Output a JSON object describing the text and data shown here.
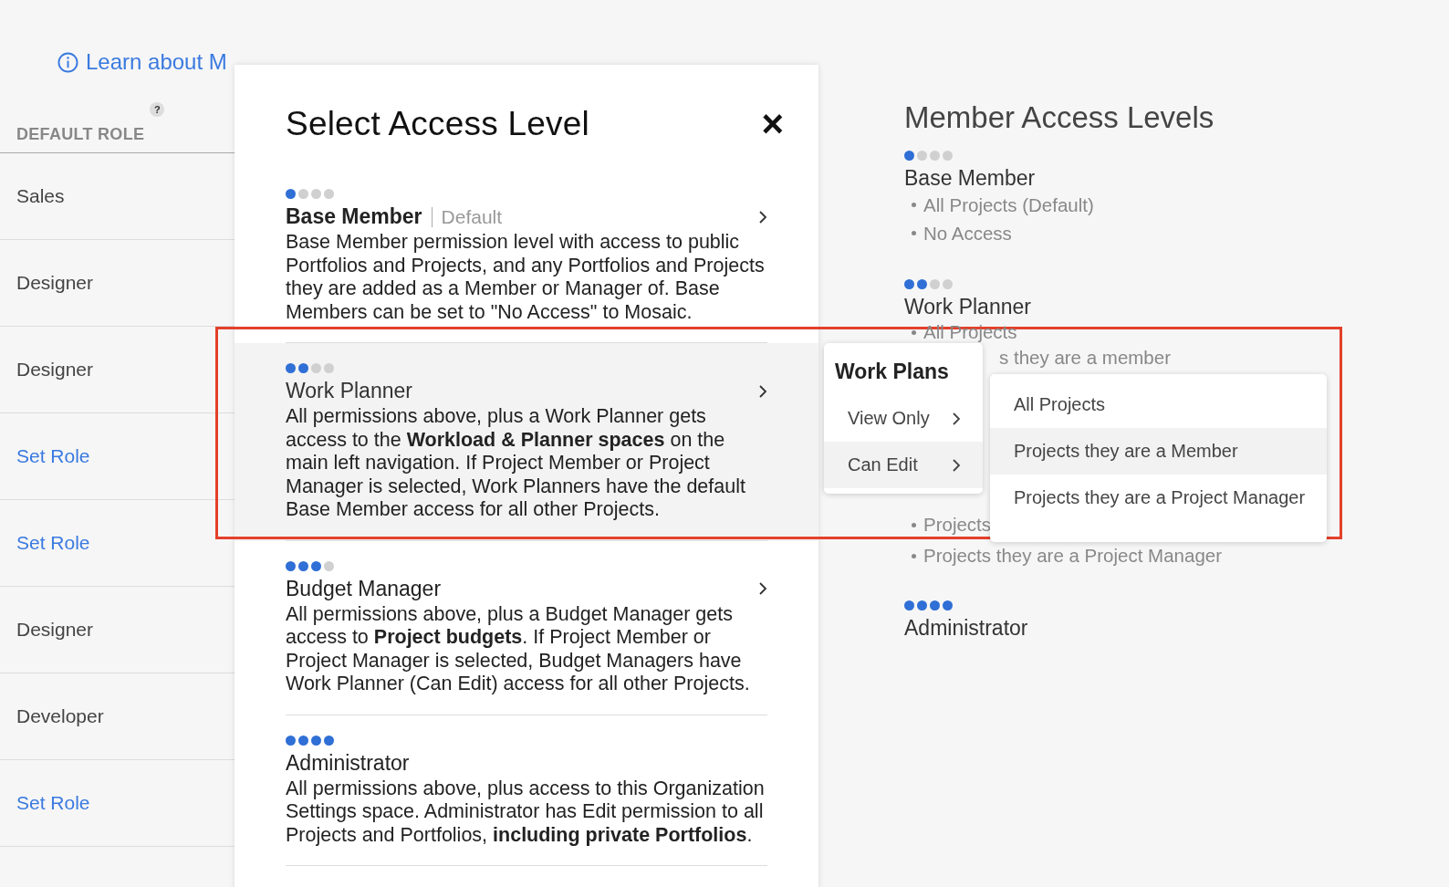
{
  "learn_link": "Learn about M",
  "roles_table": {
    "header": "DEFAULT ROLE",
    "help": "?",
    "rows": [
      {
        "text": "Sales",
        "kind": "value"
      },
      {
        "text": "Designer",
        "kind": "value"
      },
      {
        "text": "Designer",
        "kind": "value"
      },
      {
        "text": "Set Role",
        "kind": "link"
      },
      {
        "text": "Set Role",
        "kind": "link"
      },
      {
        "text": "Designer",
        "kind": "value"
      },
      {
        "text": "Developer",
        "kind": "value"
      },
      {
        "text": "Set Role",
        "kind": "link"
      }
    ]
  },
  "modal": {
    "title": "Select Access Level",
    "close": "×",
    "levels": [
      {
        "stars": 1,
        "name": "Base Member",
        "tag": "Default",
        "selected": false,
        "description": "Base Member permission level with access to public Portfolios and Projects, and any Portfolios and Projects they are added as a Member or Manager of. Base Members can be set to \"No Access\" to Mosaic."
      },
      {
        "stars": 2,
        "name": "Work Planner",
        "selected": true,
        "description": "All permissions above, plus a Work Planner gets access to the **Workload & Planner spaces** on the main left navigation. If Project Member or Project Manager is selected, Work Planners have the default Base Member access for all other Projects."
      },
      {
        "stars": 3,
        "name": "Budget Manager",
        "selected": false,
        "description": "All permissions above, plus a Budget Manager gets access to **Project budgets**. If Project Member or Project Manager is selected, Budget Managers have Work Planner (Can Edit) access for all other Projects."
      },
      {
        "stars": 4,
        "name": "Administrator",
        "selected": false,
        "description": "All permissions above, plus access to this Organization Settings space. Administrator has Edit permission to all Projects and Portfolios, **including private Portfolios**."
      }
    ]
  },
  "work_plans_menu": {
    "title": "Work Plans",
    "items": [
      {
        "label": "View Only",
        "selected": false
      },
      {
        "label": "Can Edit",
        "selected": true
      }
    ]
  },
  "submenu": {
    "items": [
      {
        "label": "All Projects",
        "selected": false
      },
      {
        "label": "Projects they are a Member",
        "selected": true
      },
      {
        "label": "Projects they are a Project Manager",
        "selected": false
      }
    ]
  },
  "member_access_levels": {
    "title": "Member Access Levels",
    "levels": [
      {
        "stars": 1,
        "name": "Base Member",
        "bullets": [
          {
            "text": "All Projects (Default)",
            "kind": "bullet"
          },
          {
            "text": "No Access",
            "kind": "bullet"
          }
        ]
      },
      {
        "stars": 2,
        "name": "Work Planner",
        "bullets": [
          {
            "text": "All Projects",
            "kind": "bullet"
          },
          {
            "text": "s they are a member",
            "kind": "tail"
          },
          {
            "text": "Projects",
            "kind": "resume"
          },
          {
            "text": "Projects they are a Project Manager",
            "kind": "bullet"
          }
        ]
      },
      {
        "stars": 4,
        "name": "Administrator"
      }
    ]
  }
}
